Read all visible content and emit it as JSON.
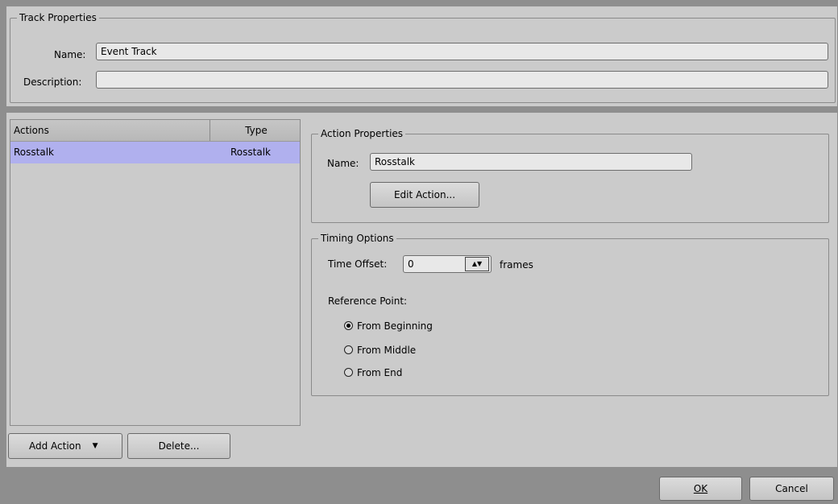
{
  "track_properties": {
    "legend": "Track Properties",
    "name_label": "Name:",
    "name_value": "Event Track",
    "description_label": "Description:",
    "description_value": ""
  },
  "actions_list": {
    "columns": [
      "Actions",
      "Type"
    ],
    "rows": [
      {
        "action": "Rosstalk",
        "type": "Rosstalk",
        "selected": true
      }
    ]
  },
  "action_properties": {
    "legend": "Action Properties",
    "name_label": "Name:",
    "name_value": "Rosstalk",
    "edit_button": "Edit Action..."
  },
  "timing_options": {
    "legend": "Timing Options",
    "time_offset_label": "Time Offset:",
    "time_offset_value": "0",
    "units": "frames",
    "reference_label": "Reference Point:",
    "reference_options": [
      {
        "label": "From Beginning",
        "checked": true
      },
      {
        "label": "From Middle",
        "checked": false
      },
      {
        "label": "From End",
        "checked": false
      }
    ]
  },
  "list_buttons": {
    "add_action": "Add Action",
    "delete": "Delete..."
  },
  "dialog_buttons": {
    "ok": "OK",
    "cancel": "Cancel"
  },
  "colors": {
    "panel": "#cbcbcb",
    "selection": "#b0b0ee",
    "outer": "#8e8e8e"
  }
}
